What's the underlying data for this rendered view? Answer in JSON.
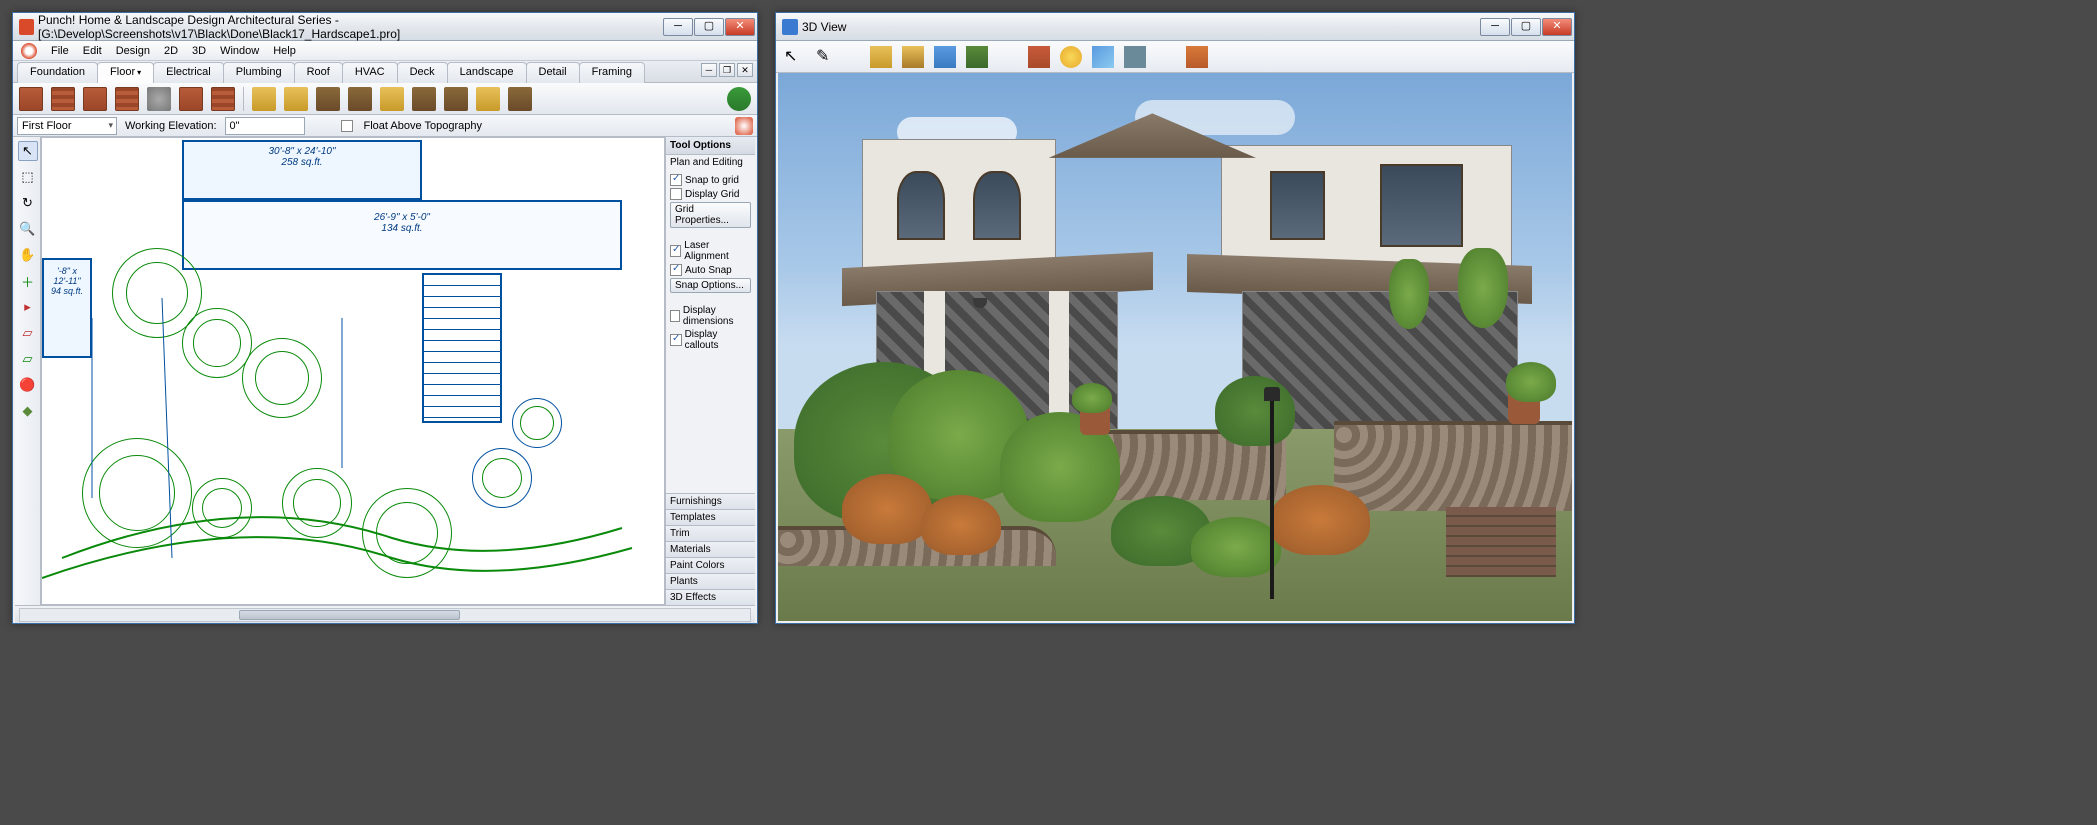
{
  "main_window": {
    "title": "Punch! Home & Landscape Design Architectural Series - [G:\\Develop\\Screenshots\\v17\\Black\\Done\\Black17_Hardscape1.pro]",
    "menus": [
      "File",
      "Edit",
      "Design",
      "2D",
      "3D",
      "Window",
      "Help"
    ],
    "plan_tabs": [
      "Foundation",
      "Floor",
      "Electrical",
      "Plumbing",
      "Roof",
      "HVAC",
      "Deck",
      "Landscape",
      "Detail",
      "Framing"
    ],
    "active_plan_tab": "Floor",
    "floor_selector": "First Floor",
    "working_elevation_label": "Working Elevation:",
    "working_elevation_value": "0\"",
    "float_above_label": "Float Above Topography",
    "rooms": [
      {
        "dims": "30'-8\" x 24'-10\"",
        "area": "258 sq.ft."
      },
      {
        "dims": "26'-9\" x 5'-0\"",
        "area": "134 sq.ft."
      },
      {
        "dims": "'-8\" x 12'-11\"",
        "area": "94 sq.ft."
      }
    ],
    "tool_options": {
      "title": "Tool Options",
      "section": "Plan and Editing",
      "snap_to_grid": "Snap to grid",
      "display_grid": "Display Grid",
      "grid_props_btn": "Grid Properties...",
      "laser_alignment": "Laser Alignment",
      "auto_snap": "Auto Snap",
      "snap_options_btn": "Snap Options...",
      "display_dimensions": "Display dimensions",
      "display_callouts": "Display callouts"
    },
    "accordion": [
      "Furnishings",
      "Templates",
      "Trim",
      "Materials",
      "Paint Colors",
      "Plants",
      "3D Effects"
    ]
  },
  "view3d_window": {
    "title": "3D View"
  }
}
